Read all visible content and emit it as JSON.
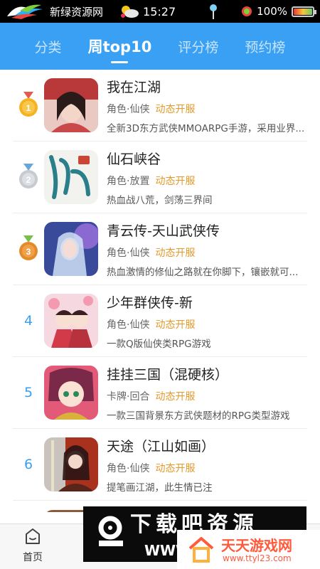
{
  "status_bar": {
    "app_name": "新绿资源网",
    "time": "15:27",
    "battery": "100%"
  },
  "tabs": [
    {
      "label": "分类",
      "active": false
    },
    {
      "label": "周top10",
      "active": true
    },
    {
      "label": "评分榜",
      "active": false
    },
    {
      "label": "预约榜",
      "active": false
    }
  ],
  "games": [
    {
      "rank": "1",
      "medal": "gold",
      "name": "我在江湖",
      "category": "角色·仙侠",
      "status": "动态开服",
      "desc": "全新3D东方武侠MMOARPG手游，采用业界..."
    },
    {
      "rank": "2",
      "medal": "silver",
      "name": "仙石峡谷",
      "category": "角色·放置",
      "status": "动态开服",
      "desc": "热血战八荒，剑荡三界间"
    },
    {
      "rank": "3",
      "medal": "bronze",
      "name": "青云传-天山武侠传",
      "category": "角色·仙侠",
      "status": "动态开服",
      "desc": "热血激情的修仙之路就在你脚下，镶嵌就可..."
    },
    {
      "rank": "4",
      "medal": "",
      "name": "少年群侠传-新",
      "category": "角色·仙侠",
      "status": "动态开服",
      "desc": "一款Q版仙侠类RPG游戏"
    },
    {
      "rank": "5",
      "medal": "",
      "name": "挂挂三国（混硬核）",
      "category": "卡牌·回合",
      "status": "动态开服",
      "desc": "一款三国背景东方武侠题材的RPG类型游戏"
    },
    {
      "rank": "6",
      "medal": "",
      "name": " 天途（江山如画）",
      "category": "角色·仙侠",
      "status": "动态开服",
      "desc": "提笔画江湖，此生情已注"
    }
  ],
  "bottom_nav": {
    "home_label": "首页"
  },
  "watermark": {
    "left_big": "下载吧资源",
    "left_small": "WWW",
    "right_title": "天天游戏网",
    "right_url": "www.ttyl23.com"
  },
  "colors": {
    "accent": "#3aa0f3",
    "status_tag": "#e39a2b"
  }
}
